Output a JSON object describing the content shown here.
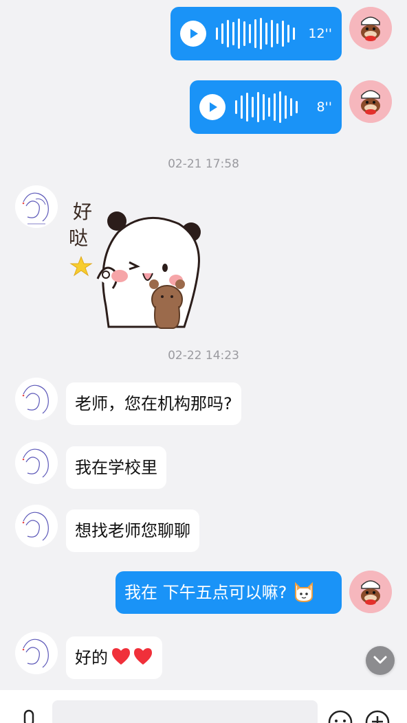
{
  "messages": {
    "voice1": {
      "duration": "12''"
    },
    "voice2": {
      "duration": "8''"
    },
    "time1": "02-21 17:58",
    "sticker": {
      "caption_line1": "好",
      "caption_line2": "哒"
    },
    "time2": "02-22 14:23",
    "msg1": "老师，您在机构那吗?",
    "msg2": "我在学校里",
    "msg3": "想找老师您聊聊",
    "msg4": "我在 下午五点可以嘛?",
    "msg5": "好的"
  },
  "input": {
    "placeholder": ""
  },
  "icons": {
    "voice_input": "microphone-icon",
    "emoji": "smiley-icon",
    "more": "plus-icon",
    "scroll": "chevron-down-icon"
  },
  "colors": {
    "my_bubble": "#1a93f7",
    "their_bubble": "#ffffff",
    "background": "#f2f2f4",
    "my_avatar_bg": "#f6b7bd"
  }
}
